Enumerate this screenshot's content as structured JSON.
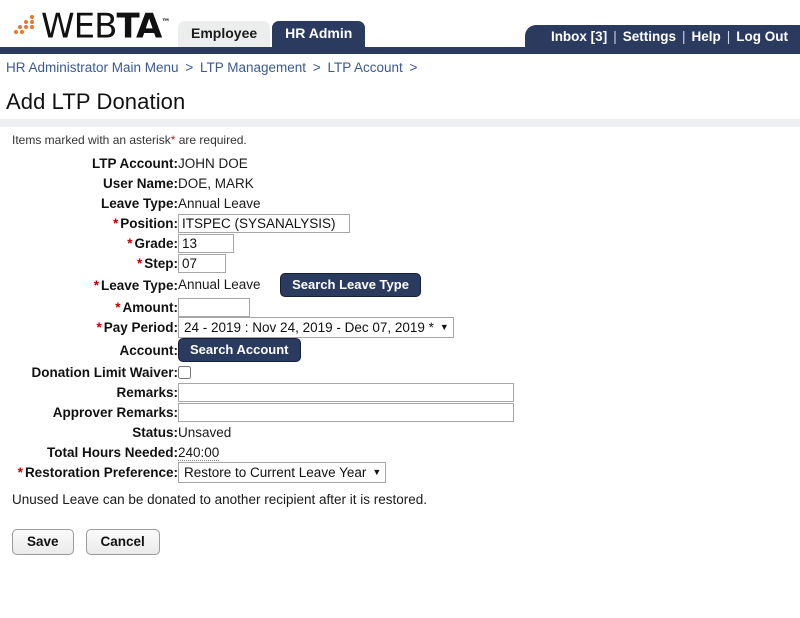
{
  "brand": {
    "name_light": "WEB",
    "name_bold": "TA",
    "trademark": "™",
    "dot_color": "#e8762c"
  },
  "tabs": [
    {
      "label": "Employee",
      "active": false
    },
    {
      "label": "HR Admin",
      "active": true
    }
  ],
  "topnav": {
    "inbox": "Inbox [3]",
    "settings": "Settings",
    "help": "Help",
    "logout": "Log Out",
    "separator": "|"
  },
  "breadcrumb": {
    "items": [
      "HR Administrator Main Menu",
      "LTP Management",
      "LTP Account"
    ],
    "separator": ">",
    "trailing_separator": ">"
  },
  "page": {
    "title": "Add LTP Donation",
    "required_note_pre": "Items marked with an asterisk",
    "required_note_star": "*",
    "required_note_post": " are required."
  },
  "form": {
    "ltp_account": {
      "label": "LTP Account:",
      "value": "JOHN DOE"
    },
    "user_name": {
      "label": "User Name:",
      "value": "DOE, MARK"
    },
    "leave_type_display": {
      "label": "Leave Type:",
      "value": "Annual Leave"
    },
    "position": {
      "label": "Position:",
      "value": "ITSPEC (SYSANALYSIS)",
      "required": true
    },
    "grade": {
      "label": "Grade:",
      "value": "13",
      "required": true
    },
    "step": {
      "label": "Step:",
      "value": "07",
      "required": true
    },
    "leave_type": {
      "label": "Leave Type:",
      "value": "Annual Leave",
      "button": "Search Leave Type",
      "required": true
    },
    "amount": {
      "label": "Amount:",
      "value": "",
      "required": true
    },
    "pay_period": {
      "label": "Pay Period:",
      "value": "24 - 2019 : Nov 24, 2019 - Dec 07, 2019 *",
      "required": true
    },
    "account": {
      "label": "Account:",
      "button": "Search Account"
    },
    "donation_limit_waiver": {
      "label": "Donation Limit Waiver:",
      "checked": false
    },
    "remarks": {
      "label": "Remarks:",
      "value": ""
    },
    "approver_remarks": {
      "label": "Approver Remarks:",
      "value": ""
    },
    "status": {
      "label": "Status:",
      "value": "Unsaved"
    },
    "total_hours_needed": {
      "label": "Total Hours Needed:",
      "value": "240:00"
    },
    "restoration_preference": {
      "label": "Restoration Preference:",
      "value": "Restore to Current Leave Year",
      "required": true
    },
    "footer_note": "Unused Leave can be donated to another recipient after it is restored."
  },
  "actions": {
    "save": "Save",
    "cancel": "Cancel"
  },
  "colors": {
    "navy": "#2b3b60",
    "link_blue": "#3a5a91",
    "required_red": "#c00000",
    "accent_orange": "#e8762c"
  }
}
